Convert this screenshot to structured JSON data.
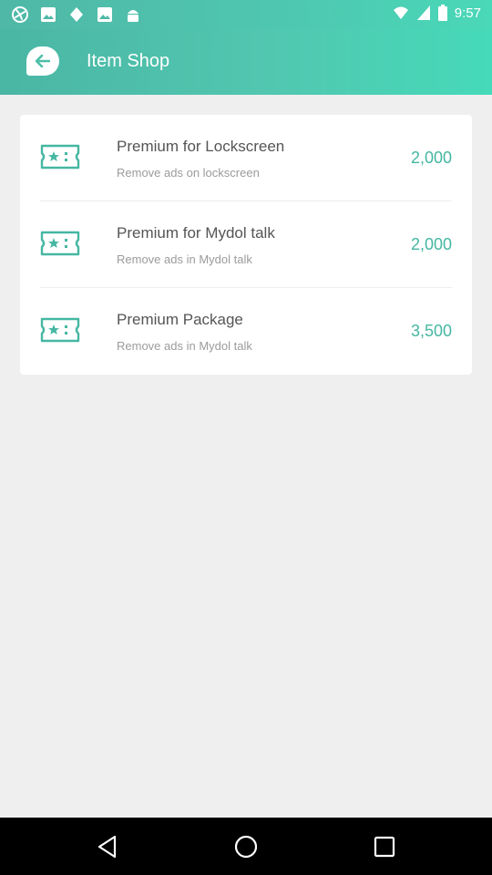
{
  "status_bar": {
    "time": "9:57",
    "icons": [
      "pinwheel-icon",
      "image-icon",
      "bag-icon",
      "image-icon",
      "android-icon"
    ]
  },
  "header": {
    "title": "Item Shop"
  },
  "items": [
    {
      "title": "Premium for Lockscreen",
      "subtitle": "Remove ads on lockscreen",
      "price": "2,000"
    },
    {
      "title": "Premium for Mydol talk",
      "subtitle": "Remove ads in Mydol talk",
      "price": "2,000"
    },
    {
      "title": "Premium Package",
      "subtitle": "Remove ads in Mydol talk",
      "price": "3,500"
    }
  ],
  "colors": {
    "accent": "#45b7a2",
    "header_gradient_start": "#4ab6a4",
    "header_gradient_end": "#45dab9",
    "background": "#efefef"
  }
}
